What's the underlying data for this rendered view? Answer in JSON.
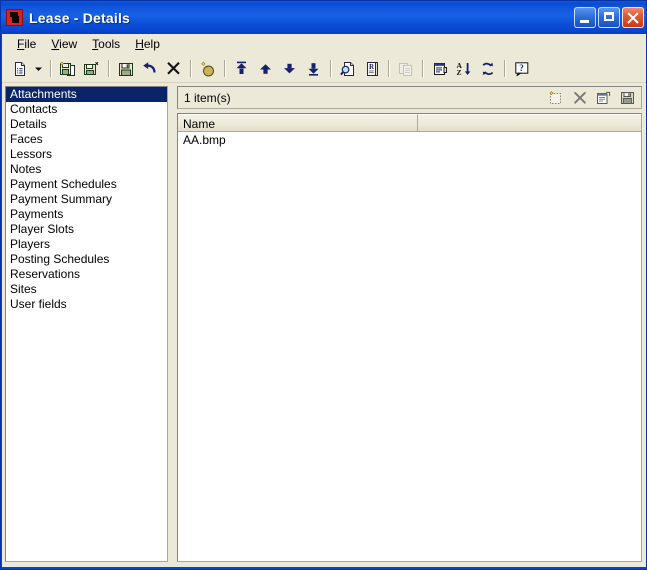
{
  "window": {
    "title": "Lease - Details",
    "app_icon": "lease-app-icon",
    "caption": {
      "minimize": "Minimize",
      "maximize": "Maximize",
      "close": "Close"
    }
  },
  "menu": {
    "items": [
      {
        "label": "File",
        "accel": "F"
      },
      {
        "label": "View",
        "accel": "V"
      },
      {
        "label": "Tools",
        "accel": "T"
      },
      {
        "label": "Help",
        "accel": "H"
      }
    ]
  },
  "toolbar": {
    "buttons": [
      {
        "name": "new-record-icon",
        "title": "New"
      },
      {
        "name": "new-record-dropdown-icon",
        "title": "New (dropdown)"
      },
      {
        "name": "save-new-icon",
        "title": "Save and New"
      },
      {
        "name": "save-close-icon",
        "title": "Save and Close"
      },
      {
        "name": "save-icon",
        "title": "Save"
      },
      {
        "name": "undo-icon",
        "title": "Undo"
      },
      {
        "name": "delete-icon",
        "title": "Delete"
      },
      {
        "name": "add-favorite-icon",
        "title": "Add to favourites"
      },
      {
        "name": "first-record-icon",
        "title": "First"
      },
      {
        "name": "previous-record-icon",
        "title": "Previous"
      },
      {
        "name": "next-record-icon",
        "title": "Next"
      },
      {
        "name": "last-record-icon",
        "title": "Last"
      },
      {
        "name": "find-icon",
        "title": "Find"
      },
      {
        "name": "report-icon",
        "title": "Report"
      },
      {
        "name": "copy-icon",
        "title": "Copy"
      },
      {
        "name": "properties-icon",
        "title": "Properties"
      },
      {
        "name": "sort-az-icon",
        "title": "Sort A-Z"
      },
      {
        "name": "refresh-icon",
        "title": "Refresh"
      },
      {
        "name": "help-icon",
        "title": "Help"
      }
    ]
  },
  "sidebar": {
    "selected_index": 0,
    "items": [
      {
        "label": "Attachments"
      },
      {
        "label": "Contacts"
      },
      {
        "label": "Details"
      },
      {
        "label": "Faces"
      },
      {
        "label": "Lessors"
      },
      {
        "label": "Notes"
      },
      {
        "label": "Payment Schedules"
      },
      {
        "label": "Payment Summary"
      },
      {
        "label": "Payments"
      },
      {
        "label": "Player Slots"
      },
      {
        "label": "Players"
      },
      {
        "label": "Posting Schedules"
      },
      {
        "label": "Reservations"
      },
      {
        "label": "Sites"
      },
      {
        "label": "User fields"
      }
    ]
  },
  "panel": {
    "count_label": "1 item(s)",
    "actions": [
      {
        "name": "new-attachment-icon",
        "title": "New"
      },
      {
        "name": "delete-attachment-icon",
        "title": "Delete"
      },
      {
        "name": "open-attachment-icon",
        "title": "Open / Properties"
      },
      {
        "name": "save-attachment-icon",
        "title": "Save"
      }
    ],
    "list": {
      "columns": [
        {
          "label": "Name"
        },
        {
          "label": ""
        }
      ],
      "rows": [
        {
          "name": "AA.bmp",
          "extra": ""
        }
      ]
    }
  },
  "colors": {
    "title_bar_blue": "#0A4BD2",
    "window_border": "#0A43C8",
    "face": "#ECE9D8",
    "selection": "#0A246A",
    "close_red": "#C93A14"
  }
}
